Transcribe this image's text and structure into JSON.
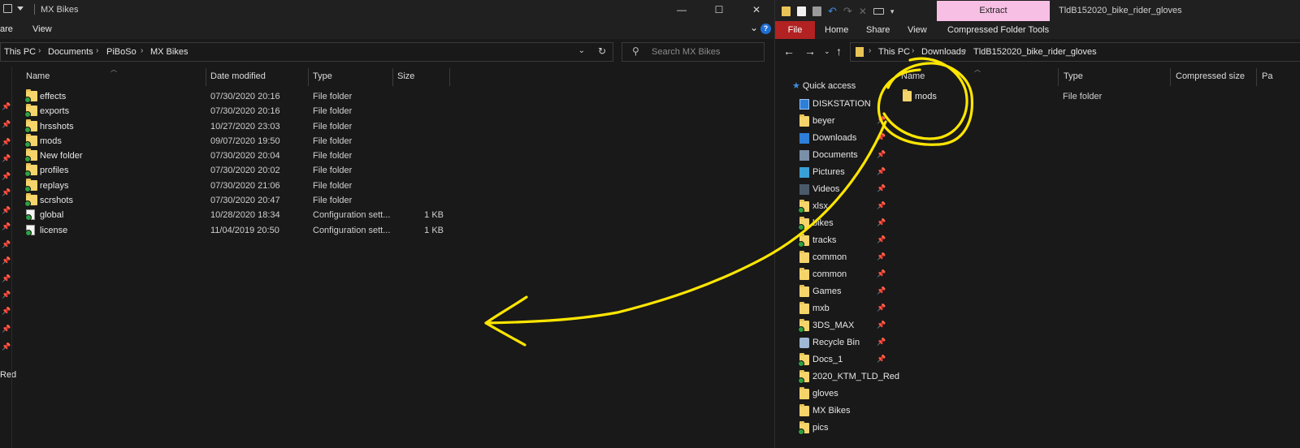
{
  "left_window": {
    "title": "MX Bikes",
    "ribbon_tabs": [
      "are",
      "View"
    ],
    "window_controls": [
      "—",
      "☐",
      "✕"
    ],
    "breadcrumb": [
      "This PC",
      "Documents",
      "PiBoSo",
      "MX Bikes"
    ],
    "search_placeholder": "Search MX Bikes",
    "columns": [
      "Name",
      "Date modified",
      "Type",
      "Size"
    ],
    "nav_partial_text": "Red",
    "files": [
      {
        "name": "effects",
        "date": "07/30/2020 20:16",
        "type": "File folder",
        "size": "",
        "icon": "folder-synced-icon"
      },
      {
        "name": "exports",
        "date": "07/30/2020 20:16",
        "type": "File folder",
        "size": "",
        "icon": "folder-synced-icon"
      },
      {
        "name": "hrsshots",
        "date": "10/27/2020 23:03",
        "type": "File folder",
        "size": "",
        "icon": "folder-synced-icon"
      },
      {
        "name": "mods",
        "date": "09/07/2020 19:50",
        "type": "File folder",
        "size": "",
        "icon": "folder-synced-icon"
      },
      {
        "name": "New folder",
        "date": "07/30/2020 20:04",
        "type": "File folder",
        "size": "",
        "icon": "folder-synced-icon"
      },
      {
        "name": "profiles",
        "date": "07/30/2020 20:02",
        "type": "File folder",
        "size": "",
        "icon": "folder-synced-icon"
      },
      {
        "name": "replays",
        "date": "07/30/2020 21:06",
        "type": "File folder",
        "size": "",
        "icon": "folder-synced-icon"
      },
      {
        "name": "scrshots",
        "date": "07/30/2020 20:47",
        "type": "File folder",
        "size": "",
        "icon": "folder-synced-icon"
      },
      {
        "name": "global",
        "date": "10/28/2020 18:34",
        "type": "Configuration sett...",
        "size": "1 KB",
        "icon": "config-file-synced-icon"
      },
      {
        "name": "license",
        "date": "11/04/2019 20:50",
        "type": "Configuration sett...",
        "size": "1 KB",
        "icon": "config-file-synced-icon"
      }
    ]
  },
  "right_window": {
    "title": "TldB152020_bike_rider_gloves",
    "extract_label": "Extract",
    "ribbon_file": "File",
    "ribbon_tabs": [
      "Home",
      "Share",
      "View",
      "Compressed Folder Tools"
    ],
    "breadcrumb": [
      "This PC",
      "Downloads",
      "TldB152020_bike_rider_gloves"
    ],
    "columns": [
      "Name",
      "Type",
      "Compressed size",
      "Pa"
    ],
    "quick_access_label": "Quick access",
    "sidebar": [
      {
        "label": "DISKSTATION",
        "icon": "monitor-icon",
        "pinned": false
      },
      {
        "label": "beyer",
        "icon": "folder-icon",
        "pinned": true
      },
      {
        "label": "Downloads",
        "icon": "download-icon",
        "pinned": true
      },
      {
        "label": "Documents",
        "icon": "documents-icon",
        "pinned": true
      },
      {
        "label": "Pictures",
        "icon": "pictures-icon",
        "pinned": true
      },
      {
        "label": "Videos",
        "icon": "videos-icon",
        "pinned": true
      },
      {
        "label": "xlsx",
        "icon": "folder-synced-icon",
        "pinned": true
      },
      {
        "label": "bikes",
        "icon": "folder-synced-icon",
        "pinned": true
      },
      {
        "label": "tracks",
        "icon": "folder-synced-icon",
        "pinned": true
      },
      {
        "label": "common",
        "icon": "folder-icon",
        "pinned": true
      },
      {
        "label": "common",
        "icon": "folder-icon",
        "pinned": true
      },
      {
        "label": "Games",
        "icon": "folder-icon",
        "pinned": true
      },
      {
        "label": "mxb",
        "icon": "folder-icon",
        "pinned": true
      },
      {
        "label": "3DS_MAX",
        "icon": "folder-synced-icon",
        "pinned": true
      },
      {
        "label": "Recycle Bin",
        "icon": "recycle-bin-icon",
        "pinned": true
      },
      {
        "label": "Docs_1",
        "icon": "folder-synced-icon",
        "pinned": true
      },
      {
        "label": "2020_KTM_TLD_Red",
        "icon": "folder-synced-icon",
        "pinned": false
      },
      {
        "label": "gloves",
        "icon": "folder-icon",
        "pinned": false
      },
      {
        "label": "MX Bikes",
        "icon": "folder-icon",
        "pinned": false
      },
      {
        "label": "pics",
        "icon": "folder-synced-icon",
        "pinned": false
      }
    ],
    "files": [
      {
        "name": "mods",
        "type": "File folder",
        "icon": "folder-icon"
      }
    ]
  },
  "annotation": {
    "color": "#ffe600",
    "meaning": "hand-drawn circle around mods with arrow pointing into left window"
  }
}
